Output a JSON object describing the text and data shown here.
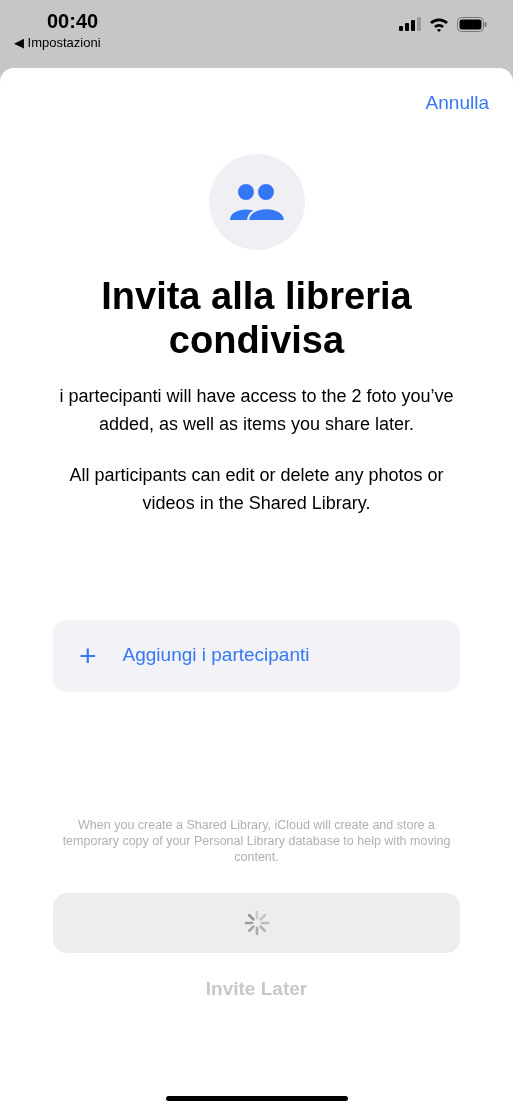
{
  "status_bar": {
    "time": "00:40",
    "back_link": "◀ Impostazioni"
  },
  "sheet": {
    "cancel": "Annulla",
    "title": "Invita alla libreria condivisa",
    "paragraphs": [
      "i partecipanti will have access to the 2 foto you’ve added, as well as items you share later.",
      "All participants can edit or delete any photos or videos in the Shared Library."
    ],
    "add_button": {
      "icon": "+",
      "label": "Aggiungi i partecipanti"
    },
    "footnote": "When you create a Shared Library, iCloud will create and store a temporary copy of your Personal Library database to help with moving content.",
    "primary_button": {
      "loading": true
    },
    "secondary_button": {
      "label": "Invite Later",
      "disabled": true
    }
  }
}
